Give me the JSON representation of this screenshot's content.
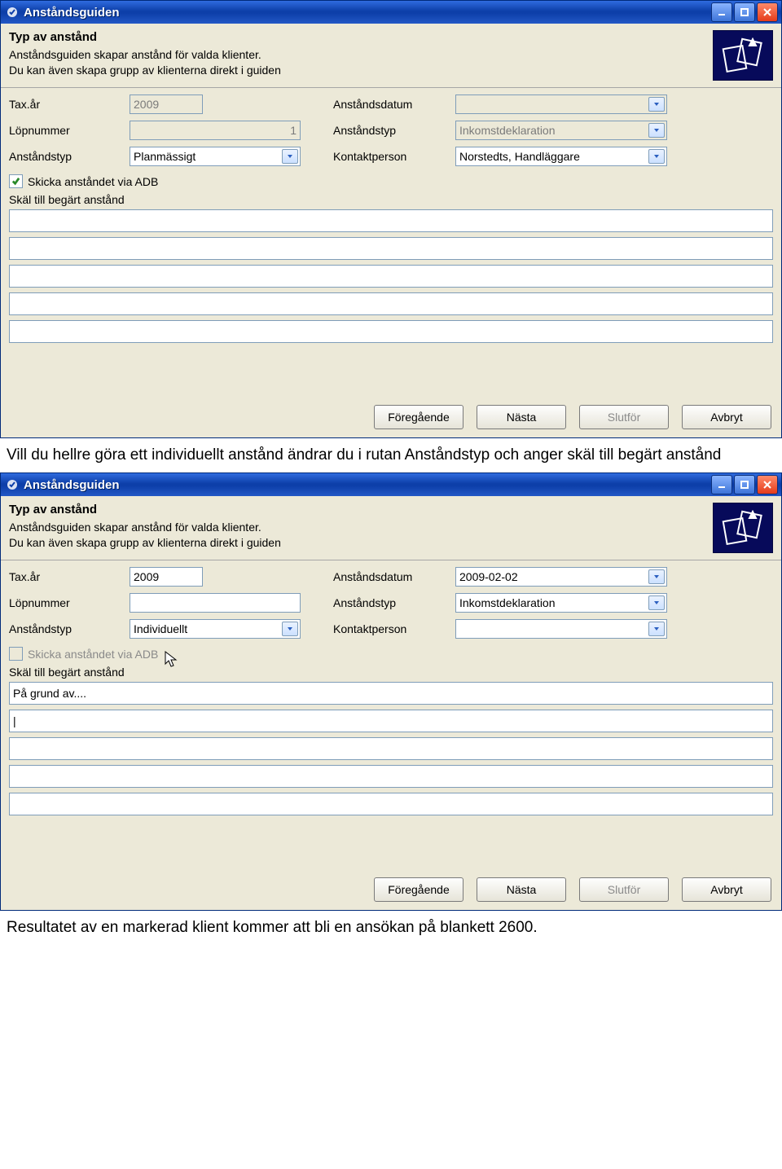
{
  "doc": {
    "mid_text": "Vill du hellre göra ett individuellt anstånd ändrar du i rutan Anståndstyp och anger skäl till begärt anstånd",
    "end_text": "Resultatet av en markerad klient kommer att bli en ansökan på blankett 2600."
  },
  "window_common": {
    "title": "Anståndsguiden",
    "hdr_title": "Typ av anstånd",
    "hdr_line1": "Anståndsguiden skapar anstånd för valda klienter.",
    "hdr_line2": "Du kan även skapa grupp av klienterna direkt i guiden",
    "labels": {
      "tax_ar": "Tax.år",
      "lopnummer": "Löpnummer",
      "anstandstyp": "Anståndstyp",
      "anstandsdatum": "Anståndsdatum",
      "anstandstyp2": "Anståndstyp",
      "kontakt": "Kontaktperson",
      "checkbox": "Skicka anståndet via ADB",
      "reason_label": "Skäl till begärt anstånd"
    },
    "buttons": {
      "prev": "Föregående",
      "next": "Nästa",
      "finish": "Slutför",
      "cancel": "Avbryt"
    }
  },
  "win1": {
    "tax_ar": "2009",
    "lopnummer": "1",
    "anstandstyp_sel": "Planmässigt",
    "date": "",
    "typ2": "Inkomstdeklaration",
    "kontakt": "Norstedts, Handläggare",
    "checkbox_checked": true,
    "checkbox_enabled": true,
    "reason_lines": [
      "",
      "",
      "",
      "",
      ""
    ]
  },
  "win2": {
    "tax_ar": "2009",
    "lopnummer": "",
    "anstandstyp_sel": "Individuellt",
    "date": "2009-02-02",
    "typ2": "Inkomstdeklaration",
    "kontakt": "",
    "checkbox_checked": false,
    "checkbox_enabled": false,
    "reason_lines": [
      "På grund av....",
      "",
      "",
      "",
      ""
    ]
  }
}
